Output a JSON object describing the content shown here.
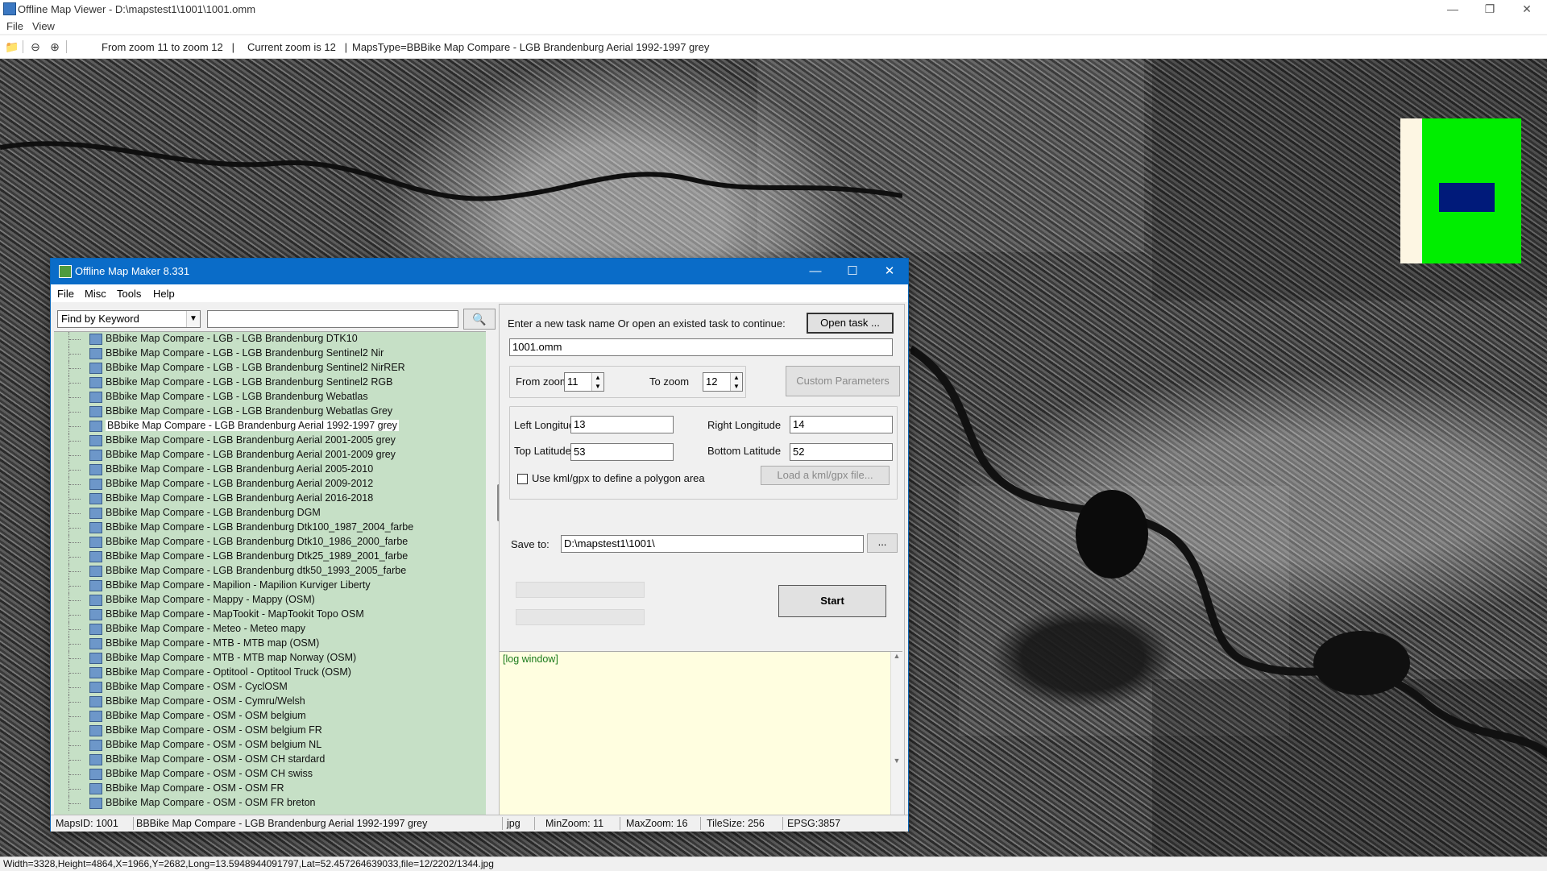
{
  "app": {
    "title": "Offline Map Viewer - D:\\mapstest1\\1001\\1001.omm",
    "menu": [
      "File",
      "View"
    ],
    "toolbar_info": {
      "zoom_range": "From zoom 11 to zoom 12   |",
      "current_zoom": "Current zoom is 12   |",
      "maps_type": "MapsType=BBBike Map Compare - LGB Brandenburg Aerial 1992-1997 grey"
    },
    "status_line": "Width=3328,Height=4864,X=1966,Y=2682,Long=13.5948944091797,Lat=52.457264639033,file=12/2202/1344.jpg"
  },
  "dialog": {
    "title": "Offline Map Maker 8.331",
    "menu": [
      "File",
      "Misc",
      "Tools",
      "Help"
    ],
    "find_mode": "Find by Keyword",
    "search_value": "",
    "tree_items": [
      "BBbike Map Compare - LGB - LGB Brandenburg DTK10",
      "BBbike Map Compare - LGB - LGB Brandenburg Sentinel2 Nir",
      "BBbike Map Compare - LGB - LGB Brandenburg Sentinel2 NirRER",
      "BBbike Map Compare - LGB - LGB Brandenburg Sentinel2 RGB",
      "BBbike Map Compare - LGB - LGB Brandenburg Webatlas",
      "BBbike Map Compare - LGB - LGB Brandenburg Webatlas Grey",
      "BBbike Map Compare - LGB Brandenburg Aerial 1992-1997 grey",
      "BBbike Map Compare - LGB Brandenburg Aerial 2001-2005 grey",
      "BBbike Map Compare - LGB Brandenburg Aerial 2001-2009 grey",
      "BBbike Map Compare - LGB Brandenburg Aerial 2005-2010",
      "BBbike Map Compare - LGB Brandenburg Aerial 2009-2012",
      "BBbike Map Compare - LGB Brandenburg Aerial 2016-2018",
      "BBbike Map Compare - LGB Brandenburg DGM",
      "BBbike Map Compare - LGB Brandenburg Dtk100_1987_2004_farbe",
      "BBbike Map Compare - LGB Brandenburg Dtk10_1986_2000_farbe",
      "BBbike Map Compare - LGB Brandenburg Dtk25_1989_2001_farbe",
      "BBbike Map Compare - LGB Brandenburg dtk50_1993_2005_farbe",
      "BBbike Map Compare - Mapilion - Mapilion Kurviger Liberty",
      "BBbike Map Compare - Mappy - Mappy (OSM)",
      "BBbike Map Compare - MapTookit - MapTookit Topo OSM",
      "BBbike Map Compare - Meteo - Meteo mapy",
      "BBbike Map Compare - MTB - MTB map (OSM)",
      "BBbike Map Compare - MTB - MTB map Norway (OSM)",
      "BBbike Map Compare - Optitool - Optitool Truck (OSM)",
      "BBbike Map Compare - OSM - CyclOSM",
      "BBbike Map Compare - OSM - Cymru/Welsh",
      "BBbike Map Compare - OSM - OSM belgium",
      "BBbike Map Compare - OSM - OSM belgium FR",
      "BBbike Map Compare - OSM - OSM belgium NL",
      "BBbike Map Compare - OSM - OSM CH stardard",
      "BBbike Map Compare - OSM - OSM CH swiss",
      "BBbike Map Compare - OSM - OSM FR",
      "BBbike Map Compare - OSM - OSM FR breton"
    ],
    "selected_index": 6,
    "task_prompt": "Enter a new task name Or open an existed task to continue:",
    "open_task_label": "Open task ...",
    "task_name": "1001.omm",
    "from_zoom_label": "From zoom",
    "from_zoom": "11",
    "to_zoom_label": "To zoom",
    "to_zoom": "12",
    "custom_params_label": "Custom Parameters",
    "left_lon_label": "Left Longitude",
    "left_lon": "13",
    "right_lon_label": "Right Longitude",
    "right_lon": "14",
    "top_lat_label": "Top Latitude",
    "top_lat": "53",
    "bottom_lat_label": "Bottom Latitude",
    "bottom_lat": "52",
    "kml_label": "Use kml/gpx to define a polygon area",
    "load_kml_label": "Load a kml/gpx file...",
    "save_to_label": "Save to:",
    "save_to": "D:\\mapstest1\\1001\\",
    "browse_label": "...",
    "start_label": "Start",
    "log_text": "[log window]",
    "status": {
      "maps_id": "MapsID: 1001",
      "map_name": "BBBike Map Compare - LGB Brandenburg Aerial 1992-1997 grey",
      "format": "jpg",
      "min_zoom": "MinZoom: 11",
      "max_zoom": "MaxZoom: 16",
      "tile_size": "TileSize: 256",
      "epsg": "EPSG:3857"
    }
  },
  "colors": {
    "tree_bg": "#c6e0c6",
    "log_bg": "#fffee0",
    "overview_green": "#00ee00",
    "overview_blue": "#001a7a",
    "dialog_title": "#0a6cc8"
  }
}
